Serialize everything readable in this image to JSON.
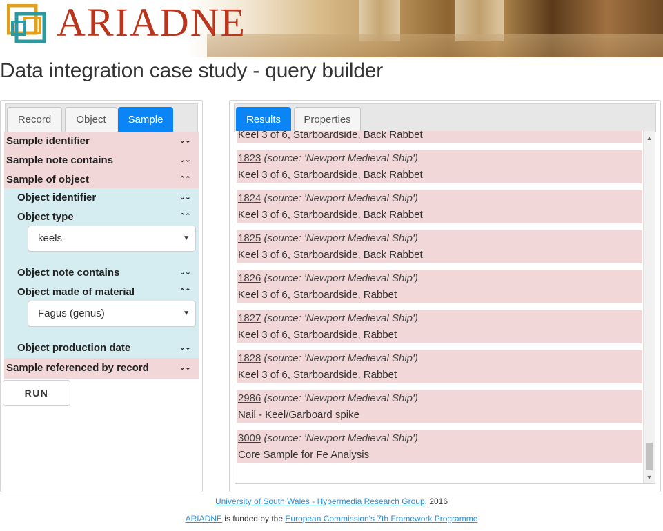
{
  "header": {
    "logo_text": "ARIADNE",
    "page_title": "Data integration case study - query builder"
  },
  "left_panel": {
    "tabs": [
      "Record",
      "Object",
      "Sample"
    ],
    "active_tab": "Sample",
    "criteria": {
      "sample_identifier": "Sample identifier",
      "sample_note_contains": "Sample note contains",
      "sample_of_object": "Sample of object",
      "object_identifier": "Object identifier",
      "object_type": "Object type",
      "object_type_value": "keels",
      "object_note_contains": "Object note contains",
      "object_made_of_material": "Object made of material",
      "material_value": "Fagus (genus)",
      "object_production_date": "Object production date",
      "sample_referenced_by_record": "Sample referenced by record"
    },
    "run_label": "RUN"
  },
  "right_panel": {
    "tabs": [
      "Results",
      "Properties"
    ],
    "active_tab": "Results",
    "results": [
      {
        "id": "",
        "source": "",
        "desc": "Keel 3 of 6, Starboardside, Back Rabbet"
      },
      {
        "id": "1823",
        "source": "(source: 'Newport Medieval Ship')",
        "desc": "Keel 3 of 6, Starboardside, Back Rabbet"
      },
      {
        "id": "1824",
        "source": "(source: 'Newport Medieval Ship')",
        "desc": "Keel 3 of 6, Starboardside, Back Rabbet"
      },
      {
        "id": "1825",
        "source": "(source: 'Newport Medieval Ship')",
        "desc": "Keel 3 of 6, Starboardside, Back Rabbet"
      },
      {
        "id": "1826",
        "source": "(source: 'Newport Medieval Ship')",
        "desc": "Keel 3 of 6, Starboardside, Rabbet"
      },
      {
        "id": "1827",
        "source": "(source: 'Newport Medieval Ship')",
        "desc": "Keel 3 of 6, Starboardside, Rabbet"
      },
      {
        "id": "1828",
        "source": "(source: 'Newport Medieval Ship')",
        "desc": "Keel 3 of 6, Starboardside, Rabbet"
      },
      {
        "id": "2986",
        "source": "(source: 'Newport Medieval Ship')",
        "desc": "Nail - Keel/Garboard spike"
      },
      {
        "id": "3009",
        "source": "(source: 'Newport Medieval Ship')",
        "desc": "Core Sample for Fe Analysis"
      }
    ]
  },
  "footer": {
    "line1_link": "University of South Wales - Hypermedia Research Group",
    "line1_suffix": ", 2016",
    "line2_link1": "ARIADNE",
    "line2_middle": " is funded by the ",
    "line2_link2": "European Commission's 7th Framework Programme"
  },
  "icons": {
    "collapsed": "chevron-double-down-icon",
    "expanded": "chevron-double-up-icon",
    "select_caret": "caret-down-icon"
  },
  "colors": {
    "accent": "#0b84f5",
    "criteria_pink": "#f1d7d7",
    "criteria_blue": "#d5ecf1",
    "logo_red": "#b8361e",
    "link": "#2a8fd6"
  }
}
